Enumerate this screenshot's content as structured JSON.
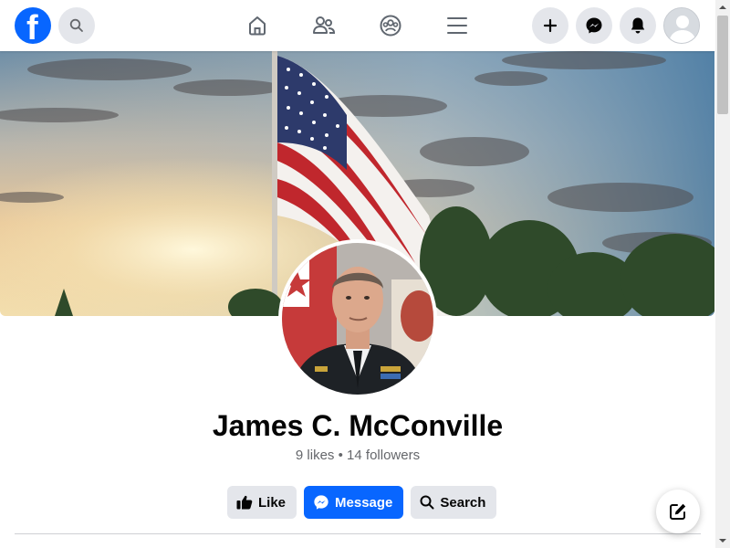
{
  "header": {
    "logo_letter": "f",
    "logo_icon": "facebook-logo-icon",
    "search_icon": "search-icon",
    "nav_items": [
      {
        "name": "home",
        "icon": "home-icon"
      },
      {
        "name": "friends",
        "icon": "friends-icon"
      },
      {
        "name": "groups",
        "icon": "groups-icon"
      },
      {
        "name": "menu",
        "icon": "menu-icon"
      }
    ],
    "right_buttons": [
      {
        "name": "create",
        "icon": "plus-icon"
      },
      {
        "name": "messenger",
        "icon": "messenger-icon"
      },
      {
        "name": "notifications",
        "icon": "bell-icon"
      },
      {
        "name": "account",
        "icon": "avatar-icon"
      }
    ]
  },
  "cover": {
    "description_icon": "american-flag-sunset-cover-image"
  },
  "profile": {
    "name": "James C. McConville",
    "likes_count": "9",
    "likes_label": "likes",
    "separator": "•",
    "followers_count": "14",
    "followers_label": "followers",
    "stats_text": "9 likes • 14 followers"
  },
  "actions": {
    "like_label": "Like",
    "message_label": "Message",
    "search_label": "Search"
  },
  "colors": {
    "brand_blue": "#0866ff",
    "button_grey": "#e4e6eb",
    "secondary_text": "#65676b"
  },
  "fab": {
    "icon": "compose-icon"
  }
}
